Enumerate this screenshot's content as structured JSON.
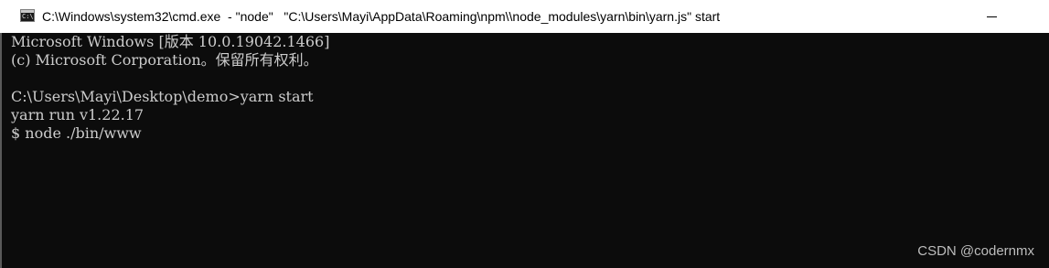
{
  "window": {
    "icon_text": "C:\\",
    "title": "C:\\Windows\\system32\\cmd.exe  - \"node\"   \"C:\\Users\\Mayi\\AppData\\Roaming\\npm\\\\node_modules\\yarn\\bin\\yarn.js\" start"
  },
  "console": {
    "lines": [
      "Microsoft Windows [版本 10.0.19042.1466]",
      "(c) Microsoft Corporation。保留所有权利。",
      "",
      "C:\\Users\\Mayi\\Desktop\\demo>yarn start",
      "yarn run v1.22.17",
      "$ node ./bin/www"
    ]
  },
  "watermark": "CSDN @codernmx",
  "colors": {
    "background": "#0c0c0c",
    "text": "#cccccc",
    "titlebar": "#ffffff"
  }
}
